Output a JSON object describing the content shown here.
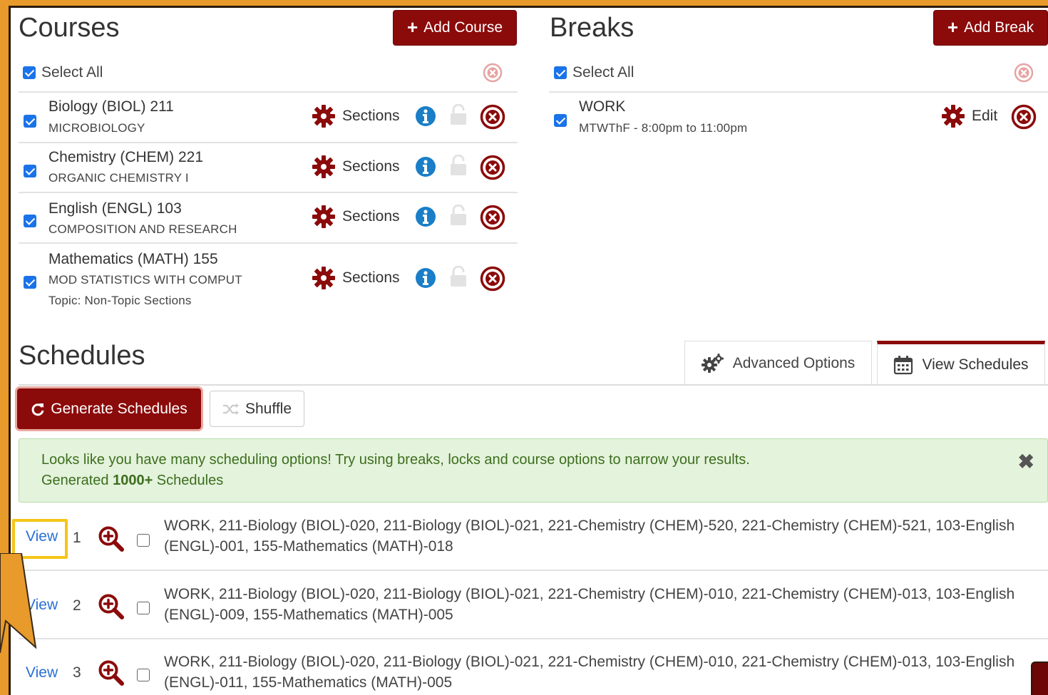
{
  "courses": {
    "title": "Courses",
    "add_label": "Add Course",
    "select_all": "Select All",
    "sections_label": "Sections",
    "items": [
      {
        "name": "Biology (BIOL) 211",
        "sub": "MICROBIOLOGY"
      },
      {
        "name": "Chemistry (CHEM) 221",
        "sub": "ORGANIC CHEMISTRY I"
      },
      {
        "name": "English (ENGL) 103",
        "sub": "COMPOSITION AND RESEARCH"
      },
      {
        "name": "Mathematics (MATH) 155",
        "sub": "MOD STATISTICS WITH COMPUT",
        "topic": "Topic: Non-Topic Sections"
      }
    ]
  },
  "breaks": {
    "title": "Breaks",
    "add_label": "Add Break",
    "select_all": "Select All",
    "items": [
      {
        "name": "WORK",
        "sub": "MTWThF - 8:00pm to 11:00pm",
        "edit_label": "Edit"
      }
    ]
  },
  "schedules": {
    "title": "Schedules",
    "tabs": [
      {
        "label": "Advanced Options",
        "icon": "gears-icon"
      },
      {
        "label": "View Schedules",
        "icon": "calendar-icon",
        "active": true
      }
    ],
    "generate_label": "Generate Schedules",
    "shuffle_label": "Shuffle",
    "alert": {
      "message": "Looks like you have many scheduling options! Try using breaks, locks and course options to narrow your results.",
      "generated_prefix": "Generated ",
      "generated_count": "1000+",
      "generated_suffix": " Schedules"
    },
    "rows": [
      {
        "view": "View",
        "num": "1",
        "text": "WORK, 211-Biology (BIOL)-020, 211-Biology (BIOL)-021, 221-Chemistry (CHEM)-520, 221-Chemistry (CHEM)-521, 103-English (ENGL)-001, 155-Mathematics (MATH)-018"
      },
      {
        "view": "View",
        "num": "2",
        "text": "WORK, 211-Biology (BIOL)-020, 211-Biology (BIOL)-021, 221-Chemistry (CHEM)-010, 221-Chemistry (CHEM)-013, 103-English (ENGL)-009, 155-Mathematics (MATH)-005"
      },
      {
        "view": "View",
        "num": "3",
        "text": "WORK, 211-Biology (BIOL)-020, 211-Biology (BIOL)-021, 221-Chemistry (CHEM)-010, 221-Chemistry (CHEM)-013, 103-English (ENGL)-011, 155-Mathematics (MATH)-005"
      }
    ]
  },
  "colors": {
    "brand": "#8b0a0a",
    "checkbox": "#1a73e8",
    "info": "#1a7ec8",
    "alert_bg": "#e4f3dc",
    "highlight": "#f5c518",
    "background": "#e89a2a"
  }
}
